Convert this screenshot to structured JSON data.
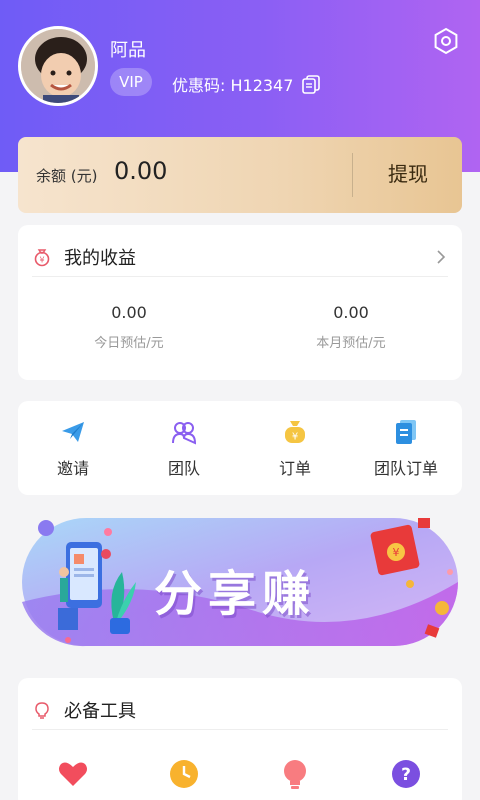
{
  "profile": {
    "username": "阿品",
    "vip_label": "VIP",
    "coupon_text": "优惠码: H12347"
  },
  "balance": {
    "label": "余额 (元)",
    "value": "0.00",
    "withdraw_label": "提现"
  },
  "earnings": {
    "title": "我的收益",
    "today_value": "0.00",
    "today_label": "今日预估/元",
    "month_value": "0.00",
    "month_label": "本月预估/元"
  },
  "menu": {
    "items": [
      {
        "label": "邀请",
        "icon": "paper-plane-icon"
      },
      {
        "label": "团队",
        "icon": "team-icon"
      },
      {
        "label": "订单",
        "icon": "money-bag-icon"
      },
      {
        "label": "团队订单",
        "icon": "document-icon"
      }
    ]
  },
  "banner": {
    "text": "分享赚"
  },
  "tools": {
    "title": "必备工具",
    "icons": [
      "heart-icon",
      "clock-icon",
      "lightbulb-icon",
      "question-icon"
    ]
  },
  "colors": {
    "header_start": "#6f5cf6",
    "header_end": "#b064f2",
    "balance_card": "#efd5b2"
  }
}
